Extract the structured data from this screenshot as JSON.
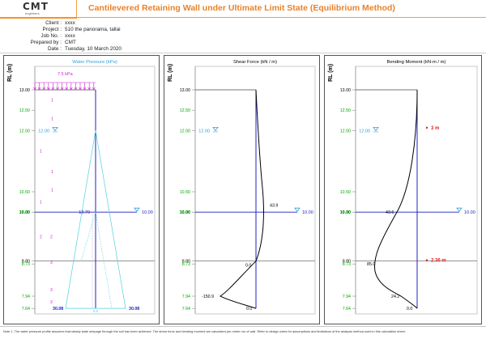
{
  "header": {
    "logo": "CMT",
    "logo_sub": "engineers",
    "title": "Cantilevered Retaining Wall under Ultimate Limit State (Equilibrium Method)",
    "rows": [
      {
        "label": "Client :",
        "value": "xxxx"
      },
      {
        "label": "Project :",
        "value": "510 the panorama, tallai"
      },
      {
        "label": "Job No. :",
        "value": "xxxx"
      },
      {
        "label": "Prepared by :",
        "value": "CMT"
      },
      {
        "label": "Date :",
        "value": "Tuesday, 10 March 2020"
      }
    ]
  },
  "axis": {
    "label": "RL  (m)",
    "ticks": [
      {
        "value": 13.0,
        "text": "13.00",
        "color": "#000000"
      },
      {
        "value": 12.5,
        "text": "12.50",
        "color": "#00aa00"
      },
      {
        "value": 12.0,
        "text": "12.00",
        "color": "#00aa00"
      },
      {
        "value": 10.5,
        "text": "10.50",
        "color": "#00aa00"
      },
      {
        "value": 10.0,
        "text": "10.00",
        "color": "#000000"
      },
      {
        "value": 10.0,
        "text": "10.00",
        "color": "#00aa00"
      },
      {
        "value": 8.8,
        "text": "8.80",
        "color": "#000000"
      },
      {
        "value": 8.73,
        "text": "8.73",
        "color": "#00aa00"
      },
      {
        "value": 7.94,
        "text": "7.94",
        "color": "#00aa00"
      },
      {
        "value": 7.64,
        "text": "7.64",
        "color": "#00aa00"
      }
    ]
  },
  "water_panel": {
    "title": "Water Pressure  (kPa)",
    "surcharge": "7.5 kPa",
    "wt_left": "12.00",
    "wt_right": "10.00",
    "pressure_exc": "13.79",
    "base_left": "30.08",
    "base_right": "30.08",
    "base_mid": "0.0",
    "layer_numbers": [
      {
        "value": 12.75,
        "text": "1"
      },
      {
        "value": 12.3,
        "text": "1"
      },
      {
        "value": 11.5,
        "text": "1"
      },
      {
        "value": 11.0,
        "text": "1"
      },
      {
        "value": 10.55,
        "text": "1"
      },
      {
        "value": 10.25,
        "text": "1"
      },
      {
        "value": 9.4,
        "text": "2"
      },
      {
        "value": 9.4,
        "text": "2"
      },
      {
        "value": 8.77,
        "text": "3"
      },
      {
        "value": 8.1,
        "text": "3"
      },
      {
        "value": 7.8,
        "text": "3"
      }
    ]
  },
  "shear_panel": {
    "title": "Shear Force  (kN / m)",
    "wt_left": "12.00",
    "wt_right": "10.00",
    "labels": [
      "43.9",
      "0.0",
      "-150.9",
      "0.0"
    ]
  },
  "moment_panel": {
    "title": "Bending Moment  (kN-m / m)",
    "wt_left": "12.00",
    "wt_right": "10.00",
    "labels": [
      "43.6",
      "85.0",
      "24.2",
      "0.0"
    ],
    "markers": [
      "3 m",
      "2.36 m"
    ]
  },
  "colors": {
    "accent": "#e8822a",
    "wall": "#2020c0",
    "water": "#30a0e0",
    "pressure": "#50d0e0",
    "surcharge": "#d020d0",
    "marker": "#e02020"
  },
  "footer": {
    "note": "Note 1. The water pressure profile assumes that steady state seepage through the soil has been achieved. The shear force and bending moment are calculated per metre run of wall. Refer to design notes for assumptions and limitations of the analysis method used in this calculation sheet."
  }
}
